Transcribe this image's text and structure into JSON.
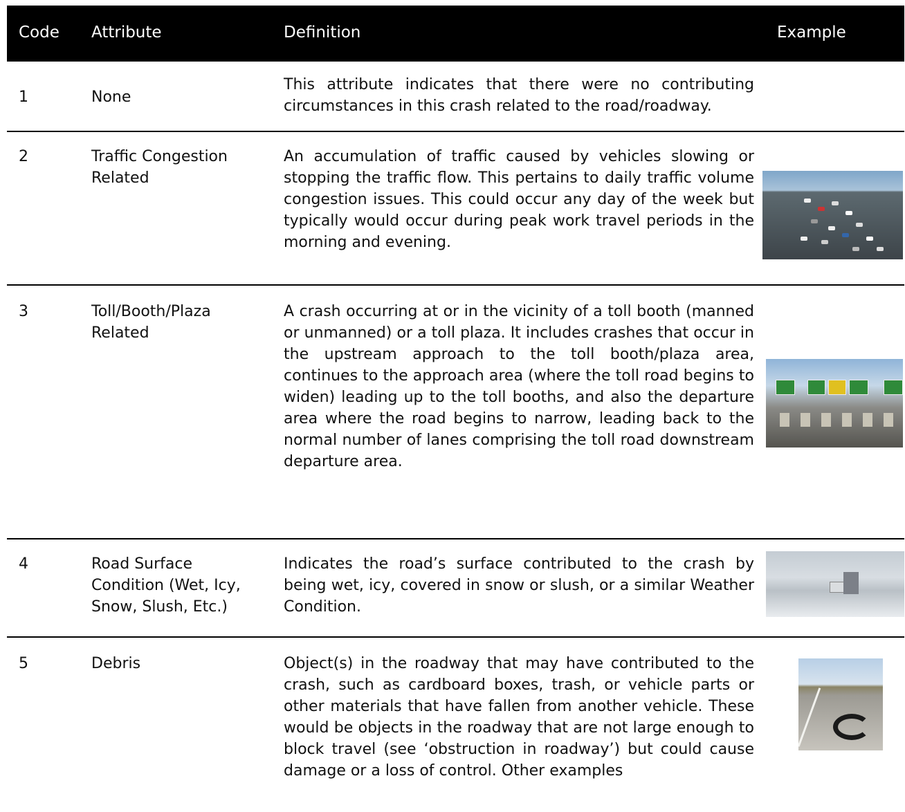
{
  "header": {
    "code": "Code",
    "attribute": "Attribute",
    "definition": "Definition",
    "example": "Example"
  },
  "rows": [
    {
      "code": "1",
      "attribute": "None",
      "definition": "This attribute indicates that there were no contributing circumstances in this crash related to the road/roadway."
    },
    {
      "code": "2",
      "attribute": "Traffic Congestion Related",
      "definition": "An accumulation of traffic caused by vehicles slowing or stopping the traffic flow. This pertains to daily traffic volume congestion issues.  This could occur any day of the week but typically would occur during peak work travel periods in the morning and evening."
    },
    {
      "code": "3",
      "attribute": "Toll/Booth/Plaza Related",
      "definition": "A crash occurring at or in the vicinity of a toll booth (manned or unmanned) or a toll plaza. It includes crashes that occur in the upstream approach to the toll booth/plaza area, continues to the approach area (where the toll road begins to widen) leading up to the toll booths, and also the departure area where the road begins to narrow, leading back to the normal number of lanes comprising the toll road downstream departure area."
    },
    {
      "code": "4",
      "attribute": "Road Surface Condition (Wet, Icy, Snow, Slush, Etc.)",
      "definition": "Indicates the road’s surface contributed to the crash by being wet, icy, covered in snow or slush, or a similar Weather Condition."
    },
    {
      "code": "5",
      "attribute": "Debris",
      "definition": "Object(s) in the roadway that may have contributed to the crash, such as cardboard boxes, trash, or vehicle parts or other materials that have fallen from another vehicle. These would be objects in the roadway that are not large enough to block travel (see ‘obstruction in roadway’) but could cause damage or a loss of control. Other examples"
    }
  ]
}
